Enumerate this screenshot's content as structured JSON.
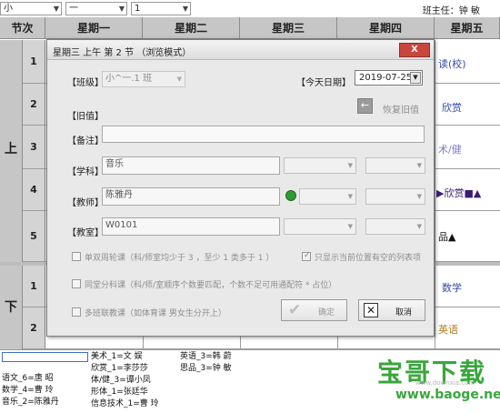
{
  "toolbar": {
    "select1": "小",
    "select2": "一",
    "select3": "1",
    "teacher_label": "班主任：钟 敏"
  },
  "schedule": {
    "header_period": "节次",
    "days": [
      "星期一",
      "星期二",
      "星期三",
      "星期四",
      "星期五"
    ],
    "halves": [
      "上",
      "下"
    ],
    "periods": [
      "1",
      "2",
      "3",
      "4",
      "5",
      "1",
      "2"
    ],
    "friday_cells": [
      "读(校)",
      "欣赏",
      "术/健",
      "▶欣赏■▲",
      "品▲",
      "数学",
      "英语"
    ]
  },
  "dialog": {
    "title": "星期三 上午 第 2 节 （浏览模式）",
    "close_label": "X",
    "class_label": "【班级】",
    "class_value": "小^一.1 班",
    "date_label": "【今天日期】",
    "date_value": "2019-07-25",
    "old_label": "【旧值】",
    "restore_label": "恢复旧值",
    "note_label": "【备注】",
    "note_value": "",
    "subject_label": "【学科】",
    "subject_value": "音乐",
    "teacher_label": "【教师】",
    "teacher_value": "陈雅丹",
    "room_label": "【教室】",
    "room_value": "W0101",
    "opt_single_double": "单双周轮课（科/师室均少于 3 ，至少 1 类多于 1 ）",
    "opt_show_empty": "只显示当前位置有空的列表项",
    "opt_same_hall": "同堂分科课（科/师/室顺序个数要匹配，个数不足可用通配符 * 占位）",
    "opt_multi_class": "多班联教课（如体育课 男女生分开上）",
    "ok_label": "确定",
    "cancel_label": "取消"
  },
  "bottom_list": {
    "col1": [
      "语文_6=唐 昭",
      "数学_4=曹 玲",
      "音乐_2=陈雅丹"
    ],
    "col2": [
      "美术_1=文 娱",
      "欣赏_1=李莎莎",
      "体/健_3=谭小凤",
      "形体_1=张廷华",
      "信息技术_1=曹 玲"
    ],
    "col3": [
      "英语_3=韩 蔚",
      "思品_3=钟 敏"
    ]
  },
  "watermark": {
    "brand": "宝哥下载",
    "url": "www.baoge.net",
    "faint": "www.downxia.com"
  },
  "colors": {
    "header_bg": "#c6c6c6",
    "dialog_bg": "#e9e9e9",
    "close_red": "#c9463d",
    "status_green": "#2e9a33",
    "watermark_green": "#3aa63c"
  }
}
